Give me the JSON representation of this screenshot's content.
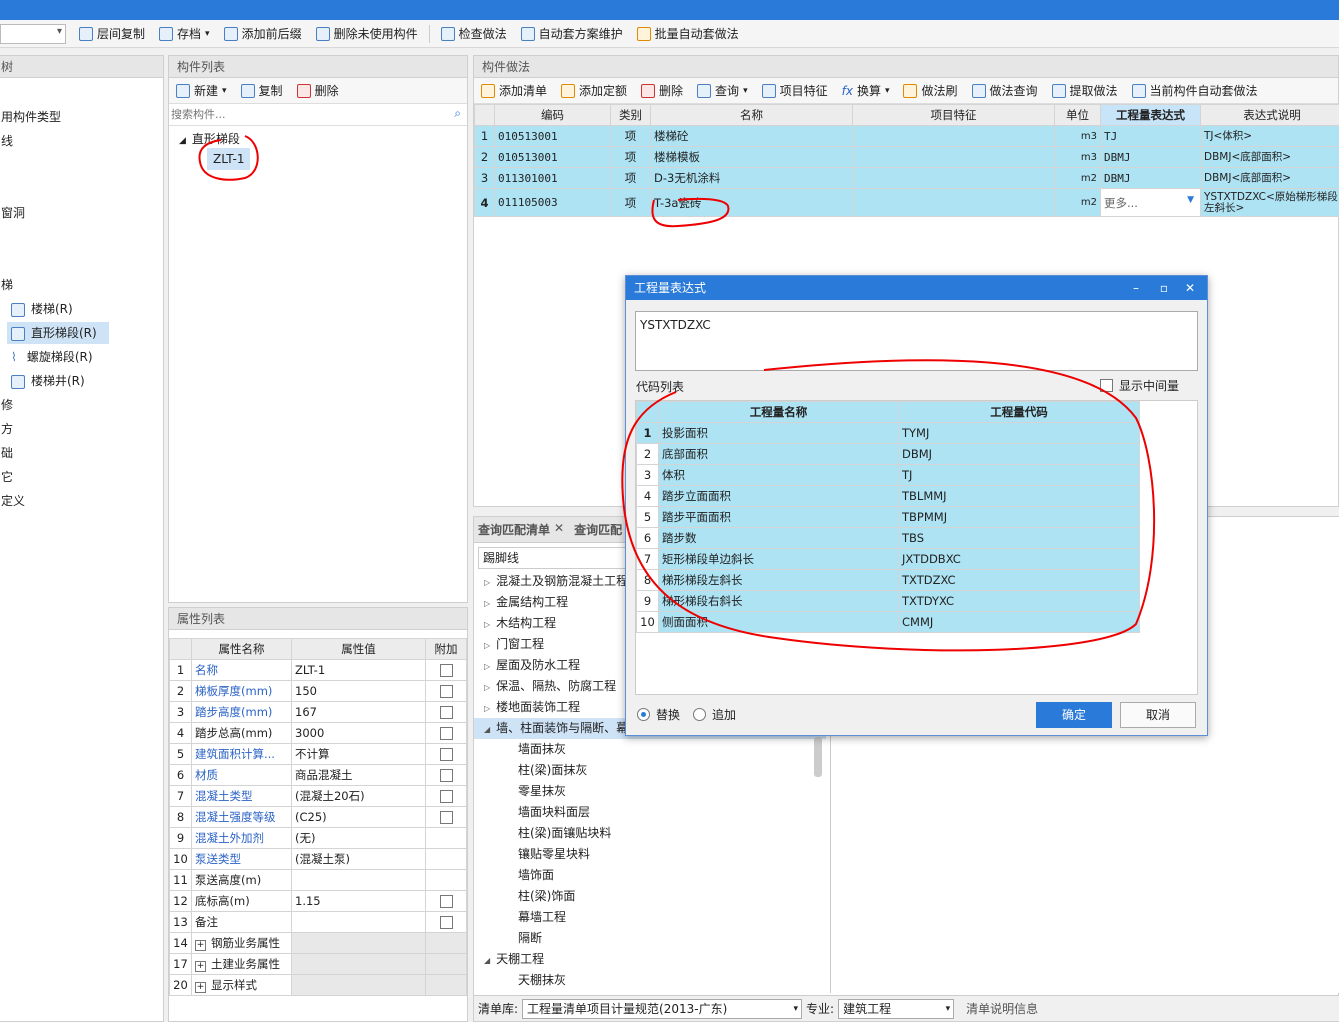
{
  "toolbar": {
    "items": [
      "层间复制",
      "存档",
      "添加前后缀",
      "删除未使用构件",
      "检查做法",
      "自动套方案维护",
      "批量自动套做法"
    ]
  },
  "left_tree": {
    "title": "树",
    "items": [
      "用构件类型",
      "线",
      "",
      "",
      "窗洞",
      "",
      "",
      "梯",
      "楼梯(R)",
      "直形梯段(R)",
      "螺旋梯段(R)",
      "楼梯井(R)",
      "修",
      "方",
      "础",
      "它",
      "定义"
    ]
  },
  "component_list": {
    "title": "构件列表",
    "new": "新建",
    "copy": "复制",
    "delete": "删除",
    "search_placeholder": "搜索构件...",
    "group": "直形梯段",
    "item": "ZLT-1"
  },
  "props": {
    "title": "属性列表",
    "headers": [
      "属性名称",
      "属性值",
      "附加"
    ],
    "rows": [
      {
        "n": "1",
        "name": "名称",
        "value": "ZLT-1"
      },
      {
        "n": "2",
        "name": "梯板厚度(mm)",
        "value": "150"
      },
      {
        "n": "3",
        "name": "踏步高度(mm)",
        "value": "167"
      },
      {
        "n": "4",
        "name": "踏步总高(mm)",
        "value": "3000"
      },
      {
        "n": "5",
        "name": "建筑面积计算...",
        "value": "不计算"
      },
      {
        "n": "6",
        "name": "材质",
        "value": "商品混凝土"
      },
      {
        "n": "7",
        "name": "混凝土类型",
        "value": "(混凝土20石)"
      },
      {
        "n": "8",
        "name": "混凝土强度等级",
        "value": "(C25)"
      },
      {
        "n": "9",
        "name": "混凝土外加剂",
        "value": "(无)"
      },
      {
        "n": "10",
        "name": "泵送类型",
        "value": "(混凝土泵)"
      },
      {
        "n": "11",
        "name": "泵送高度(m)",
        "value": ""
      },
      {
        "n": "12",
        "name": "底标高(m)",
        "value": "1.15"
      },
      {
        "n": "13",
        "name": "备注",
        "value": ""
      },
      {
        "n": "14",
        "name": "钢筋业务属性",
        "value": ""
      },
      {
        "n": "17",
        "name": "土建业务属性",
        "value": ""
      },
      {
        "n": "20",
        "name": "显示样式",
        "value": ""
      }
    ]
  },
  "method": {
    "title": "构件做法",
    "toolbar": [
      "添加清单",
      "添加定额",
      "删除",
      "查询",
      "项目特征",
      "换算",
      "做法刷",
      "做法查询",
      "提取做法",
      "当前构件自动套做法"
    ],
    "headers": [
      "编码",
      "类别",
      "名称",
      "项目特征",
      "单位",
      "工程量表达式",
      "表达式说明"
    ],
    "rows": [
      {
        "n": "1",
        "code": "010513001",
        "cat": "项",
        "name": "楼梯砼",
        "unit": "m3",
        "expr": "TJ",
        "desc": "TJ<体积>"
      },
      {
        "n": "2",
        "code": "010513001",
        "cat": "项",
        "name": "楼梯模板",
        "unit": "m3",
        "expr": "DBMJ",
        "desc": "DBMJ<底部面积>"
      },
      {
        "n": "3",
        "code": "011301001",
        "cat": "项",
        "name": "D-3无机涂料",
        "unit": "m2",
        "expr": "DBMJ",
        "desc": "DBMJ<底部面积>"
      },
      {
        "n": "4",
        "code": "011105003",
        "cat": "项",
        "name": "T-3a瓷砖",
        "unit": "m2",
        "expr": "更多...",
        "desc": "YSTXTDZXC<原始梯形梯段左斜长>"
      }
    ]
  },
  "query": {
    "tab1": "查询匹配清单",
    "tab2": "查询匹配",
    "search_value": "踢脚线",
    "tree": [
      "混凝土及钢筋混凝土工程",
      "金属结构工程",
      "木结构工程",
      "门窗工程",
      "屋面及防水工程",
      "保温、隔热、防腐工程",
      "楼地面装饰工程",
      "墙、柱面装饰与隔断、幕",
      "墙面抹灰",
      "柱(梁)面抹灰",
      "零星抹灰",
      "墙面块料面层",
      "柱(梁)面镶贴块料",
      "镶贴零星块料",
      "墙饰面",
      "柱(梁)饰面",
      "幕墙工程",
      "隔断",
      "天棚工程",
      "天棚抹灰"
    ],
    "lib_label": "清单库:",
    "lib_value": "工程量清单项目计量规范(2013-广东)",
    "major_label": "专业:",
    "major_value": "建筑工程",
    "info": "清单说明信息"
  },
  "dialog": {
    "title": "工程量表达式",
    "expression": "YSTXTDZXC",
    "code_list_label": "代码列表",
    "show_mid": "显示中间量",
    "headers": [
      "工程量名称",
      "工程量代码"
    ],
    "rows": [
      {
        "n": "1",
        "name": "投影面积",
        "code": "TYMJ"
      },
      {
        "n": "2",
        "name": "底部面积",
        "code": "DBMJ"
      },
      {
        "n": "3",
        "name": "体积",
        "code": "TJ"
      },
      {
        "n": "4",
        "name": "踏步立面面积",
        "code": "TBLMMJ"
      },
      {
        "n": "5",
        "name": "踏步平面面积",
        "code": "TBPMMJ"
      },
      {
        "n": "6",
        "name": "踏步数",
        "code": "TBS"
      },
      {
        "n": "7",
        "name": "矩形梯段单边斜长",
        "code": "JXTDDBXC"
      },
      {
        "n": "8",
        "name": "梯形梯段左斜长",
        "code": "TXTDZXC"
      },
      {
        "n": "9",
        "name": "梯形梯段右斜长",
        "code": "TXTDYXC"
      },
      {
        "n": "10",
        "name": "侧面面积",
        "code": "CMMJ"
      }
    ],
    "replace": "替换",
    "append": "追加",
    "ok": "确定",
    "cancel": "取消"
  }
}
